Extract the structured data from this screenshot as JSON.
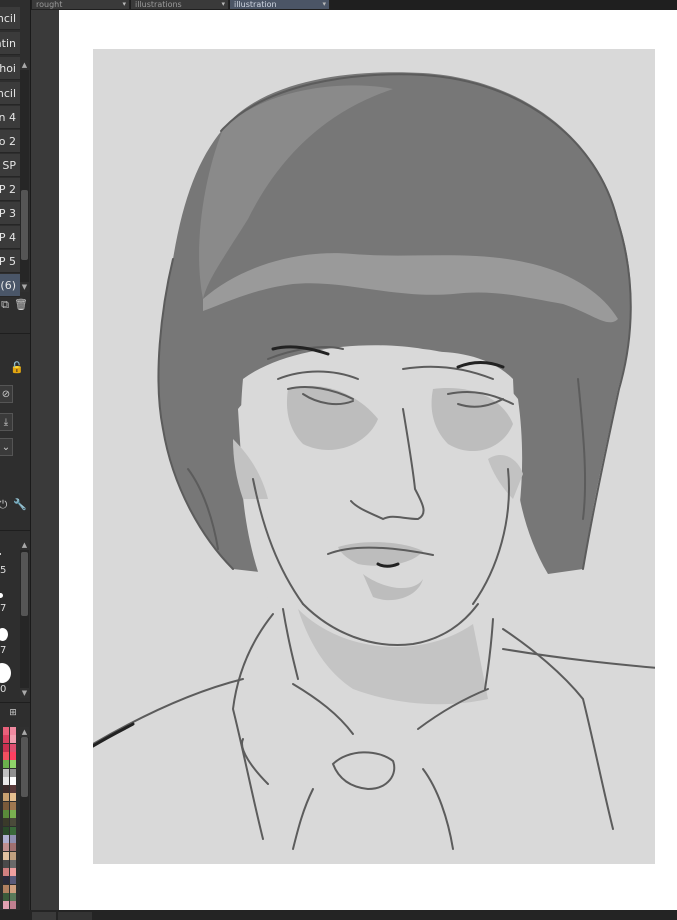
{
  "tabs": [
    {
      "label": "rought",
      "active": false
    },
    {
      "label": "illustrations",
      "active": false
    },
    {
      "label": "illustration",
      "active": true
    }
  ],
  "subtools": [
    {
      "label": "Pencil"
    },
    {
      "label": "paintin"
    },
    {
      "label": "Choi"
    },
    {
      "label": "Pencil"
    },
    {
      "label": "n 4"
    },
    {
      "label": "o 2"
    },
    {
      "label": "SP"
    },
    {
      "label": "P 2"
    },
    {
      "label": "P 3"
    },
    {
      "label": "P 4"
    },
    {
      "label": "P 5"
    },
    {
      "label": "(6)"
    }
  ],
  "brush_sizes": [
    "5",
    "7",
    "7",
    "0"
  ],
  "icons": {
    "duplicate": "duplicate-icon",
    "delete": "trash-icon",
    "lock": "unlock-icon",
    "clear": "circle-slash-icon",
    "download": "download-icon",
    "dropdown": "chevron-down-icon",
    "reset": "power-icon",
    "settings": "wrench-icon"
  },
  "colors": {
    "panel": "#2e2e2e",
    "active_tab": "#4b5566",
    "canvas_bg": "#d9d9d9",
    "hair": "#7a7a7a",
    "line": "#5c5c5c"
  }
}
